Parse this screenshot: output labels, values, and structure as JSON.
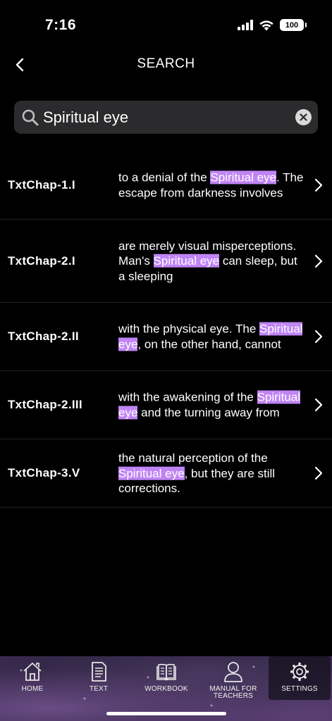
{
  "status_bar": {
    "time": "7:16",
    "battery": "100"
  },
  "header": {
    "title": "SEARCH"
  },
  "search": {
    "value": "Spiritual eye"
  },
  "results": [
    {
      "chapter": "TxtChap-1.I",
      "snippet": [
        {
          "t": "to a denial of the "
        },
        {
          "t": "Spiritual eye",
          "hl": true
        },
        {
          "t": ". The escape from darkness involves"
        }
      ]
    },
    {
      "chapter": "TxtChap-2.I",
      "snippet": [
        {
          "t": "are merely visual misperceptions. Man's "
        },
        {
          "t": "Spiritual eye",
          "hl": true
        },
        {
          "t": " can sleep, but a sleeping"
        }
      ]
    },
    {
      "chapter": "TxtChap-2.II",
      "snippet": [
        {
          "t": "with the physical eye. The "
        },
        {
          "t": "Spiritual eye",
          "hl": true
        },
        {
          "t": ", on the other hand, cannot"
        }
      ]
    },
    {
      "chapter": "TxtChap-2.III",
      "snippet": [
        {
          "t": "with the awakening of the "
        },
        {
          "t": "Spiritual eye",
          "hl": true
        },
        {
          "t": " and the turning away from"
        }
      ]
    },
    {
      "chapter": "TxtChap-3.V",
      "snippet": [
        {
          "t": "the natural perception of the "
        },
        {
          "t": "Spiritual eye",
          "hl": true
        },
        {
          "t": ", but they are still corrections."
        }
      ]
    }
  ],
  "tabs": [
    {
      "label": "HOME",
      "icon": "home-icon"
    },
    {
      "label": "TEXT",
      "icon": "document-icon"
    },
    {
      "label": "WORKBOOK",
      "icon": "book-icon"
    },
    {
      "label": "MANUAL FOR\nTEACHERS",
      "icon": "person-icon"
    },
    {
      "label": "SETTINGS",
      "icon": "gear-icon",
      "active": true
    }
  ],
  "colors": {
    "highlight": "#c084f5",
    "search_bg": "#2b2b2d",
    "background": "#000000"
  }
}
